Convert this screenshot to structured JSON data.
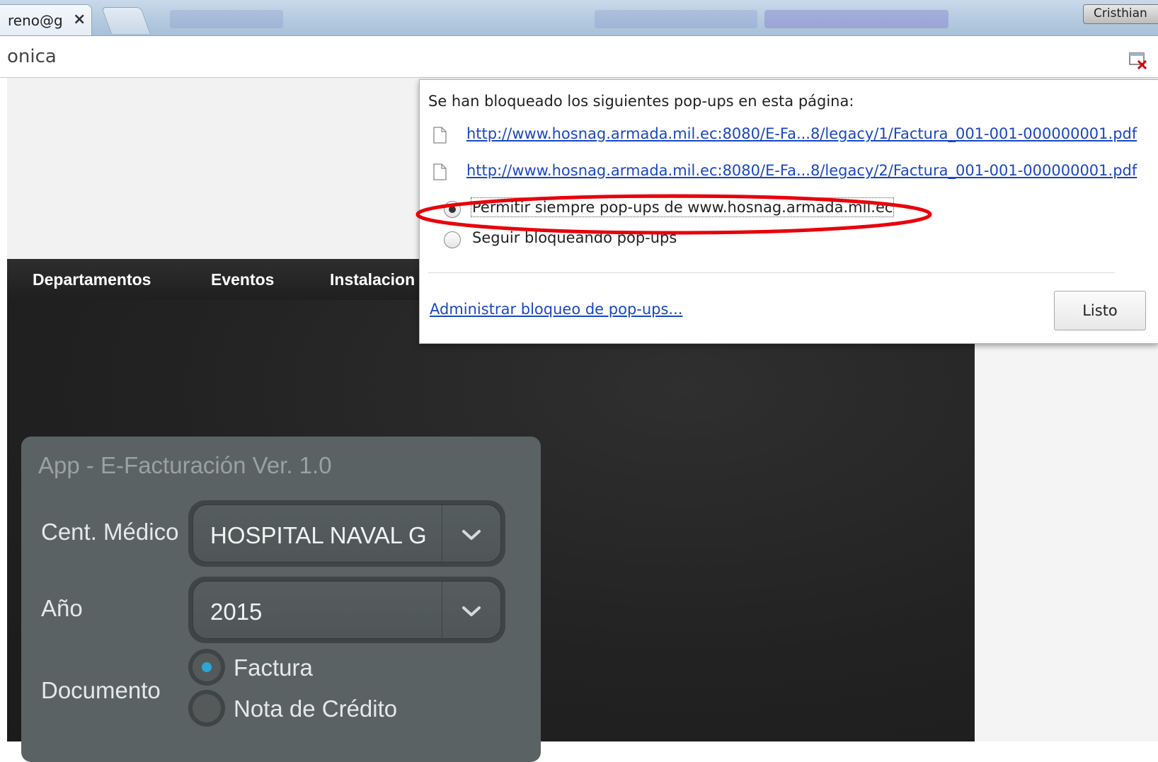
{
  "browser": {
    "tab_title": "reno@g",
    "tab_close": "×",
    "profile_name": "Cristhian",
    "address_text": "onica"
  },
  "site_nav": {
    "items": [
      "Departamentos",
      "Eventos",
      "Instalacion"
    ]
  },
  "app": {
    "title": "App - E-Facturación Ver. 1.0",
    "fields": {
      "center_label": "Cent. Médico",
      "center_value": "HOSPITAL NAVAL G",
      "year_label": "Año",
      "year_value": "2015",
      "document_label": "Documento"
    },
    "document_options": [
      {
        "label": "Factura",
        "selected": true
      },
      {
        "label": "Nota de Crédito",
        "selected": false
      }
    ]
  },
  "popup_blocker": {
    "heading": "Se han bloqueado los siguientes pop-ups en esta página:",
    "links": [
      "http://www.hosnag.armada.mil.ec:8080/E-Fa...8/legacy/1/Factura_001-001-000000001.pdf",
      "http://www.hosnag.armada.mil.ec:8080/E-Fa...8/legacy/2/Factura_001-001-000000001.pdf"
    ],
    "options": [
      {
        "label": "Permitir siempre pop-ups de www.hosnag.armada.mil.ec",
        "selected": true
      },
      {
        "label": "Seguir bloqueando pop-ups",
        "selected": false
      }
    ],
    "manage_link": "Administrar bloqueo de pop-ups...",
    "done_label": "Listo"
  },
  "colors": {
    "accent_radio": "#2aa7d6",
    "link": "#1a47c2",
    "highlight": "#e8000b"
  }
}
